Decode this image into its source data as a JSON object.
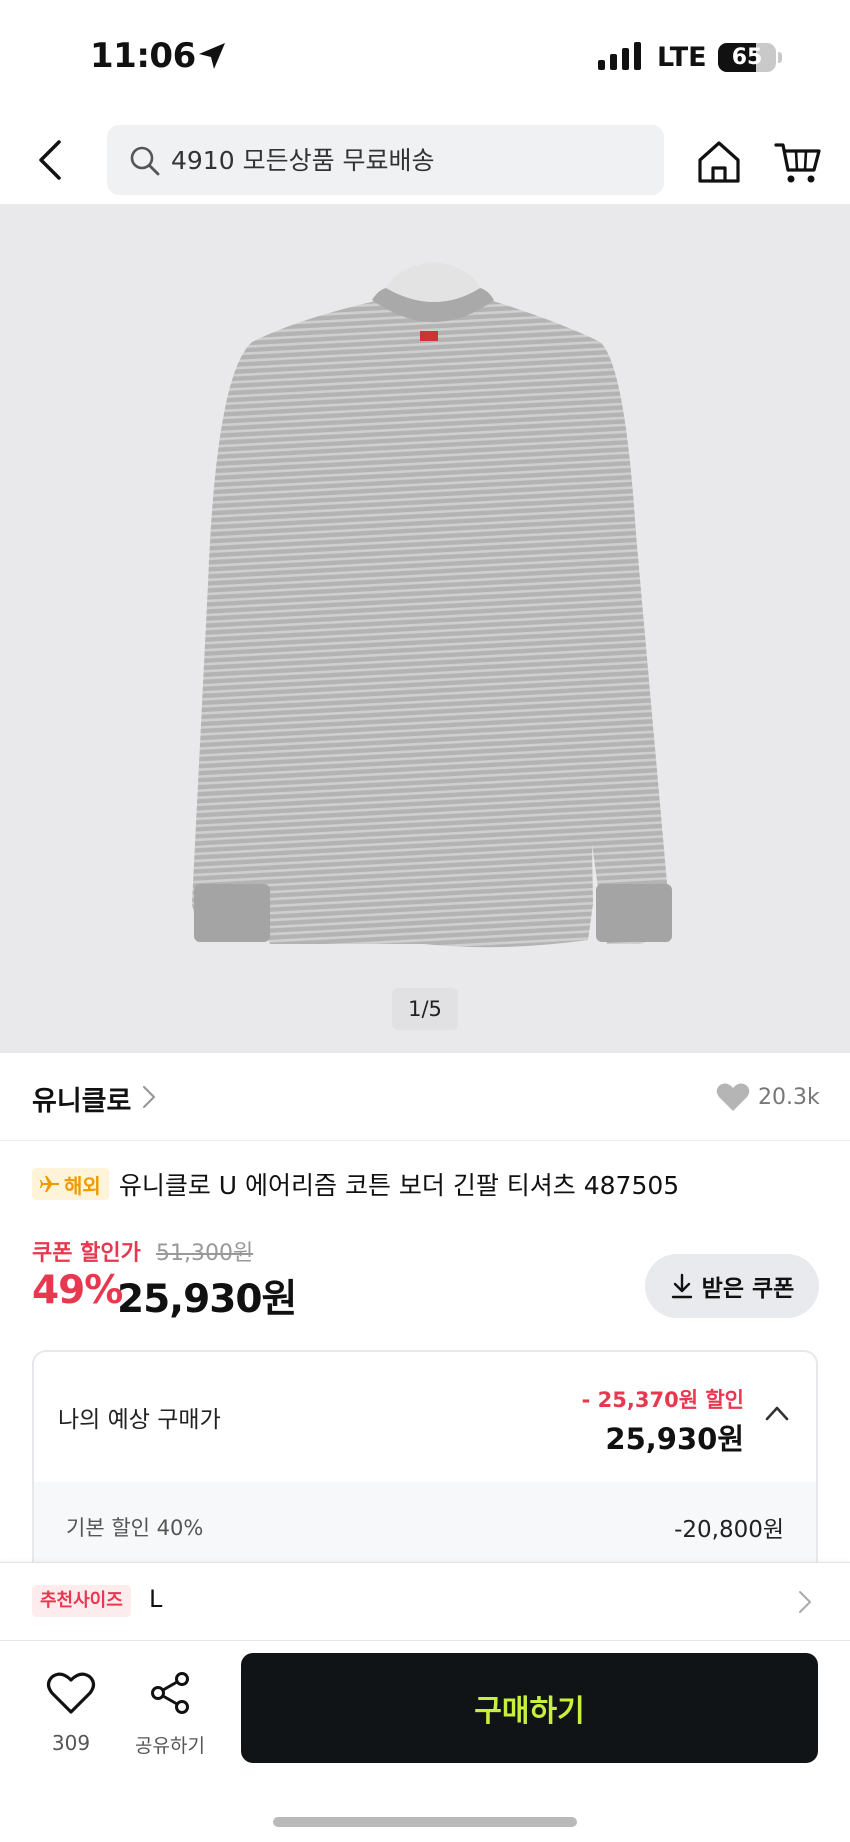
{
  "status_bar": {
    "time": "11:06",
    "network": "LTE",
    "battery_percent": 65,
    "battery_label": "65"
  },
  "header": {
    "search_placeholder": "4910 모든상품 무료배송"
  },
  "gallery": {
    "counter": "1/5"
  },
  "brand": {
    "name": "유니클로",
    "likes": "20.3k"
  },
  "product": {
    "overseas_badge": "해외",
    "title": "유니클로 U 에어리즘 코튼 보더 긴팔 티셔츠 487505"
  },
  "price": {
    "coupon_label": "쿠폰 할인가",
    "original": "51,300원",
    "discount_rate": "49%",
    "sale": "25,930원",
    "coupon_button": "받은 쿠폰"
  },
  "estimate": {
    "label": "나의 예상 구매가",
    "discount": "- 25,370원 할인",
    "price": "25,930원",
    "detail_label": "기본 할인 40%",
    "detail_value": "-20,800원"
  },
  "size": {
    "badge": "추천사이즈",
    "value": "L"
  },
  "bottom_bar": {
    "wish_count": "309",
    "share_label": "공유하기",
    "buy_label": "구매하기"
  },
  "colors": {
    "accent_red": "#e8384f",
    "buy_text": "#c8f03c",
    "buy_bg": "#111417",
    "overseas_orange": "#ee9a00"
  }
}
